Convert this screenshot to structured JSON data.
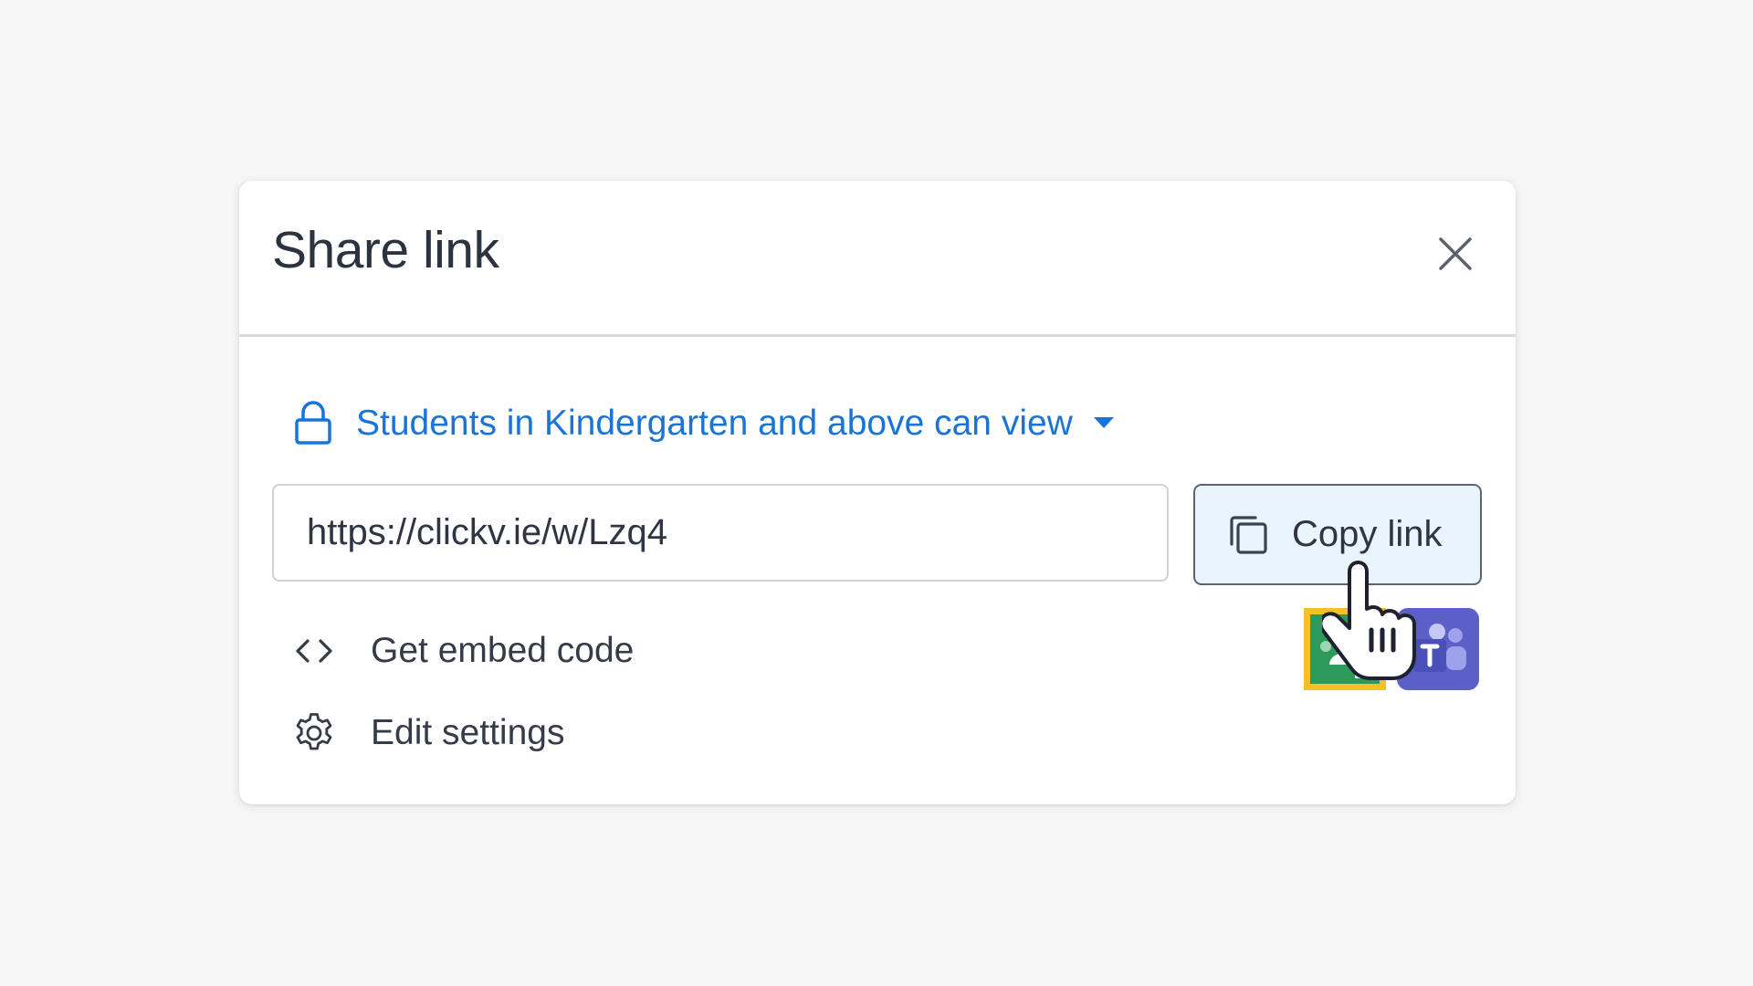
{
  "dialog": {
    "title": "Share link",
    "close_icon": "close-icon"
  },
  "visibility": {
    "label": "Students in Kindergarten and above can view",
    "icon": "lock-icon",
    "color": "#1a74d8"
  },
  "link": {
    "value": "https://clickv.ie/w/Lzq4"
  },
  "copy_button": {
    "label": "Copy link",
    "icon": "copy-icon",
    "background": "#eaf4fd"
  },
  "actions": {
    "embed_label": "Get embed code",
    "settings_label": "Edit settings"
  },
  "integrations": {
    "classroom_icon": "google-classroom-icon",
    "teams_icon": "microsoft-teams-icon"
  },
  "cursor": "hand-pointer-cursor-icon"
}
